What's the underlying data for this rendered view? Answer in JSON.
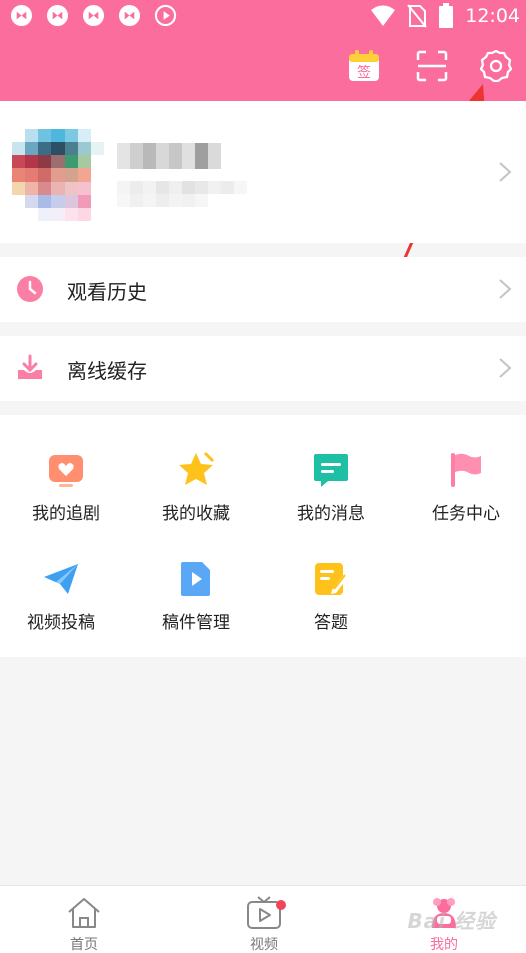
{
  "status_bar": {
    "time": "12:04",
    "left_icons": [
      "app-notification-icon",
      "app-notification-icon",
      "app-notification-icon",
      "app-notification-icon",
      "play-circle-icon"
    ],
    "right_icons": [
      "wifi-icon",
      "no-sim-icon",
      "battery-icon"
    ]
  },
  "header": {
    "sign_in_label": "签",
    "buttons": [
      "calendar-signin-icon",
      "scan-icon",
      "settings-gear-icon"
    ],
    "background_color": "#fb6d9d"
  },
  "menu": {
    "history_label": "观看历史",
    "offline_label": "离线缓存"
  },
  "grid": {
    "items": [
      {
        "label": "我的追剧",
        "icon": "tv-heart-icon",
        "color": "#ff8f6e"
      },
      {
        "label": "我的收藏",
        "icon": "star-icon",
        "color": "#ffc21a"
      },
      {
        "label": "我的消息",
        "icon": "message-icon",
        "color": "#1dbfa5"
      },
      {
        "label": "任务中心",
        "icon": "flag-icon",
        "color": "#ff7ea4"
      },
      {
        "label": "视频投稿",
        "icon": "paper-plane-icon",
        "color": "#3ea0f0"
      },
      {
        "label": "稿件管理",
        "icon": "video-file-icon",
        "color": "#5aa8f5"
      },
      {
        "label": "答题",
        "icon": "edit-note-icon",
        "color": "#ffc21a"
      }
    ]
  },
  "tabbar": {
    "tabs": [
      {
        "label": "首页",
        "icon": "home-icon"
      },
      {
        "label": "视频",
        "icon": "tv-play-icon"
      },
      {
        "label": "我的",
        "icon": "profile-mascot-icon"
      }
    ],
    "active_color": "#fb6d9d"
  },
  "watermark": "Bai 经验"
}
